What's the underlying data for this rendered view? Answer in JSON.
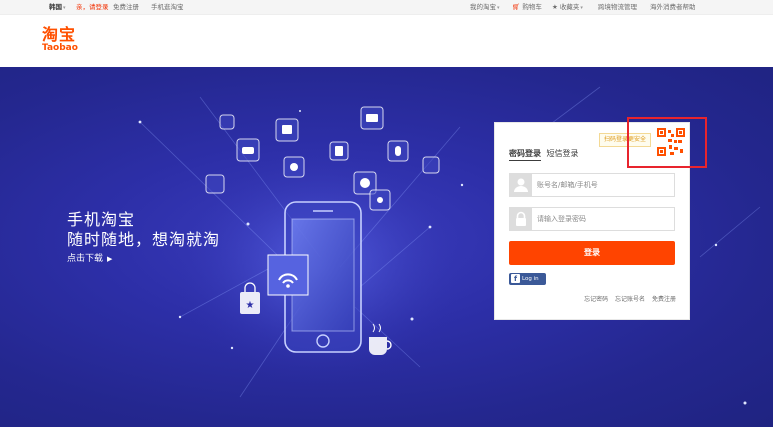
{
  "topbar": {
    "left": {
      "region": "韩国",
      "greeting": "亲，请登录",
      "register": "免费注册",
      "mobile": "手机逛淘宝"
    },
    "right": {
      "my_taobao": "我的淘宝",
      "cart": "购物车",
      "favorites": "收藏夹",
      "logistics": "跨境物流管理",
      "help": "海外消费者帮助"
    }
  },
  "logo": {
    "cn": "淘宝",
    "en": "Taobao"
  },
  "slogan": {
    "line1": "手机淘宝",
    "line2": "随时随地，想淘就淘",
    "download": "点击下载"
  },
  "login": {
    "tabs": [
      "密码登录",
      "短信登录"
    ],
    "qr_tip": "扫码登录更安全",
    "username_placeholder": "账号名/邮箱/手机号",
    "password_placeholder": "请输入登录密码",
    "submit": "登录",
    "facebook": "Log in",
    "links": [
      "忘记密码",
      "忘记账号名",
      "免费注册"
    ]
  },
  "colors": {
    "brand": "#ff5000",
    "button": "#ff4400",
    "banner": "#2d2fa8",
    "facebook": "#3b5998",
    "highlight": "#e8242d"
  },
  "icons": [
    "user-icon",
    "lock-icon",
    "qr-code-icon",
    "cart-icon",
    "star-icon",
    "facebook-icon",
    "play-triangle-icon"
  ]
}
